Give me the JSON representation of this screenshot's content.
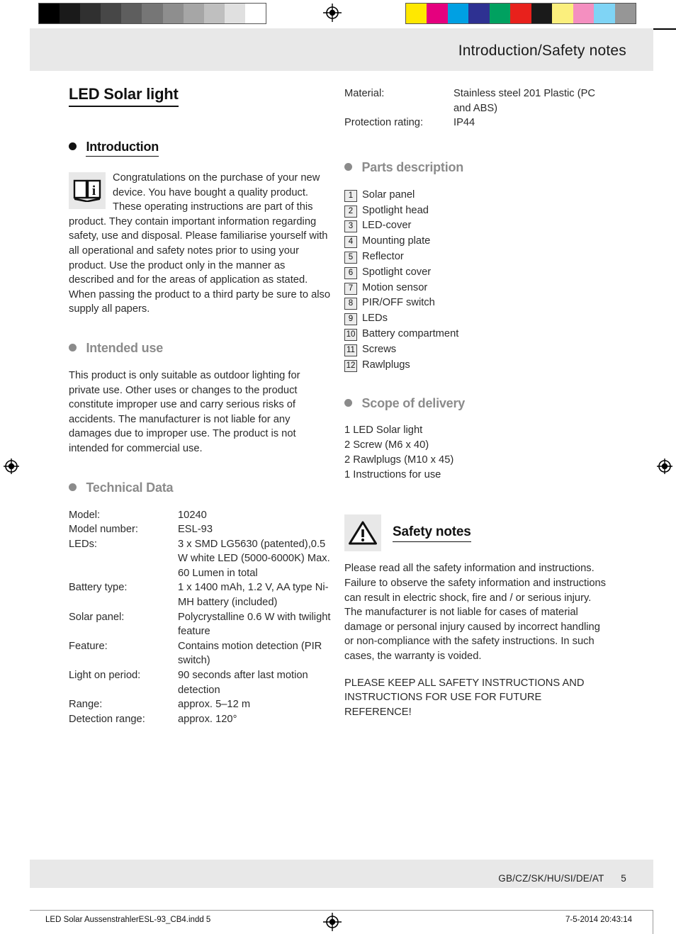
{
  "header": {
    "title": "Introduction/Safety notes"
  },
  "doc": {
    "title": "LED Solar light"
  },
  "left_column": {
    "introduction": {
      "heading": "Introduction",
      "icon": "open-book-info-icon",
      "body": "Congratulations on the purchase of your new device. You have bought a quality product. These operating instructions are part of this product. They contain important information regarding safety, use and disposal. Please familiarise yourself with all operational and safety notes prior to using your product. Use the product only in the manner as described and for the areas of application as stated. When passing the product to a third party be sure to also supply all papers."
    },
    "intended_use": {
      "heading": "Intended use",
      "body": "This product is only suitable as outdoor lighting for private use. Other uses or changes to the product constitute improper use and carry serious risks of accidents. The manufacturer is not liable for any damages due to improper use. The product is not intended for commercial use."
    },
    "technical_data": {
      "heading": "Technical Data",
      "rows": [
        {
          "key": "Model:",
          "value": "10240"
        },
        {
          "key": "Model number:",
          "value": "ESL-93"
        },
        {
          "key": "LEDs:",
          "value": "3 x SMD LG5630 (patented),0.5 W white LED (5000-6000K) Max. 60 Lumen in total"
        },
        {
          "key": "Battery type:",
          "value": "1 x 1400 mAh, 1.2 V, AA type Ni-MH battery (included)"
        },
        {
          "key": "Solar panel:",
          "value": "Polycrystalline 0.6 W with twilight feature"
        },
        {
          "key": "Feature:",
          "value": "Contains motion detection (PIR switch)"
        },
        {
          "key": "Light on period:",
          "value": "90 seconds after last motion detection"
        },
        {
          "key": "Range:",
          "value": "approx. 5–12 m"
        },
        {
          "key": "Detection range:",
          "value": "approx. 120°"
        }
      ]
    }
  },
  "right_column": {
    "technical_data_continued": {
      "rows": [
        {
          "key": "Material:",
          "value": "Stainless steel 201 Plastic (PC and ABS)"
        },
        {
          "key": "Protection rating:",
          "value": "IP44"
        }
      ]
    },
    "parts_description": {
      "heading": "Parts description",
      "items": [
        {
          "num": "1",
          "label": "Solar panel"
        },
        {
          "num": "2",
          "label": "Spotlight head"
        },
        {
          "num": "3",
          "label": "LED-cover"
        },
        {
          "num": "4",
          "label": "Mounting plate"
        },
        {
          "num": "5",
          "label": "Reflector"
        },
        {
          "num": "6",
          "label": "Spotlight cover"
        },
        {
          "num": "7",
          "label": "Motion sensor"
        },
        {
          "num": "8",
          "label": "PIR/OFF switch"
        },
        {
          "num": "9",
          "label": "LEDs"
        },
        {
          "num": "10",
          "label": "Battery compartment"
        },
        {
          "num": "11",
          "label": "Screws"
        },
        {
          "num": "12",
          "label": "Rawlplugs"
        }
      ]
    },
    "scope_of_delivery": {
      "heading": "Scope of delivery",
      "items": [
        "1 LED Solar light",
        "2 Screw (M6 x 40)",
        "2 Rawlplugs (M10 x 45)",
        "1 Instructions for use"
      ]
    },
    "safety_notes": {
      "heading": "Safety notes",
      "icon": "warning-triangle-icon",
      "body": "Please read all the safety information and instructions. Failure to observe the safety information and instructions can result in electric shock, fire and / or serious injury. The manufacturer is not liable for cases of material damage or personal injury caused by incorrect handling or non-compliance with the safety instructions. In such cases, the warranty is voided.",
      "keep_notice": "PLEASE KEEP ALL SAFETY INSTRUCTIONS AND INSTRUCTIONS FOR USE FOR FUTURE REFERENCE!"
    }
  },
  "footer": {
    "languages": "GB/CZ/SK/HU/SI/DE/AT",
    "page_number": "5"
  },
  "print_line": {
    "file": "LED Solar AussenstrahlerESL-93_CB4.indd   5",
    "timestamp": "7-5-2014   20:43:14"
  },
  "calibration": {
    "grayscale": [
      "#000000",
      "#1a1a1a",
      "#303030",
      "#474747",
      "#5e5e5e",
      "#767676",
      "#8e8e8e",
      "#a6a6a6",
      "#bfbfbf",
      "#e0e0e0",
      "#ffffff"
    ],
    "colors": [
      "#ffe800",
      "#e5007e",
      "#00a0e3",
      "#2e3192",
      "#00a160",
      "#e8211c",
      "#1a1a1a",
      "#fbef7d",
      "#f48fc0",
      "#7fd4f5",
      "#969696"
    ]
  },
  "colors": {
    "band_gray": "#e8e8e8",
    "heading_gray": "#8b8b8b",
    "text": "#2b2b2b"
  }
}
